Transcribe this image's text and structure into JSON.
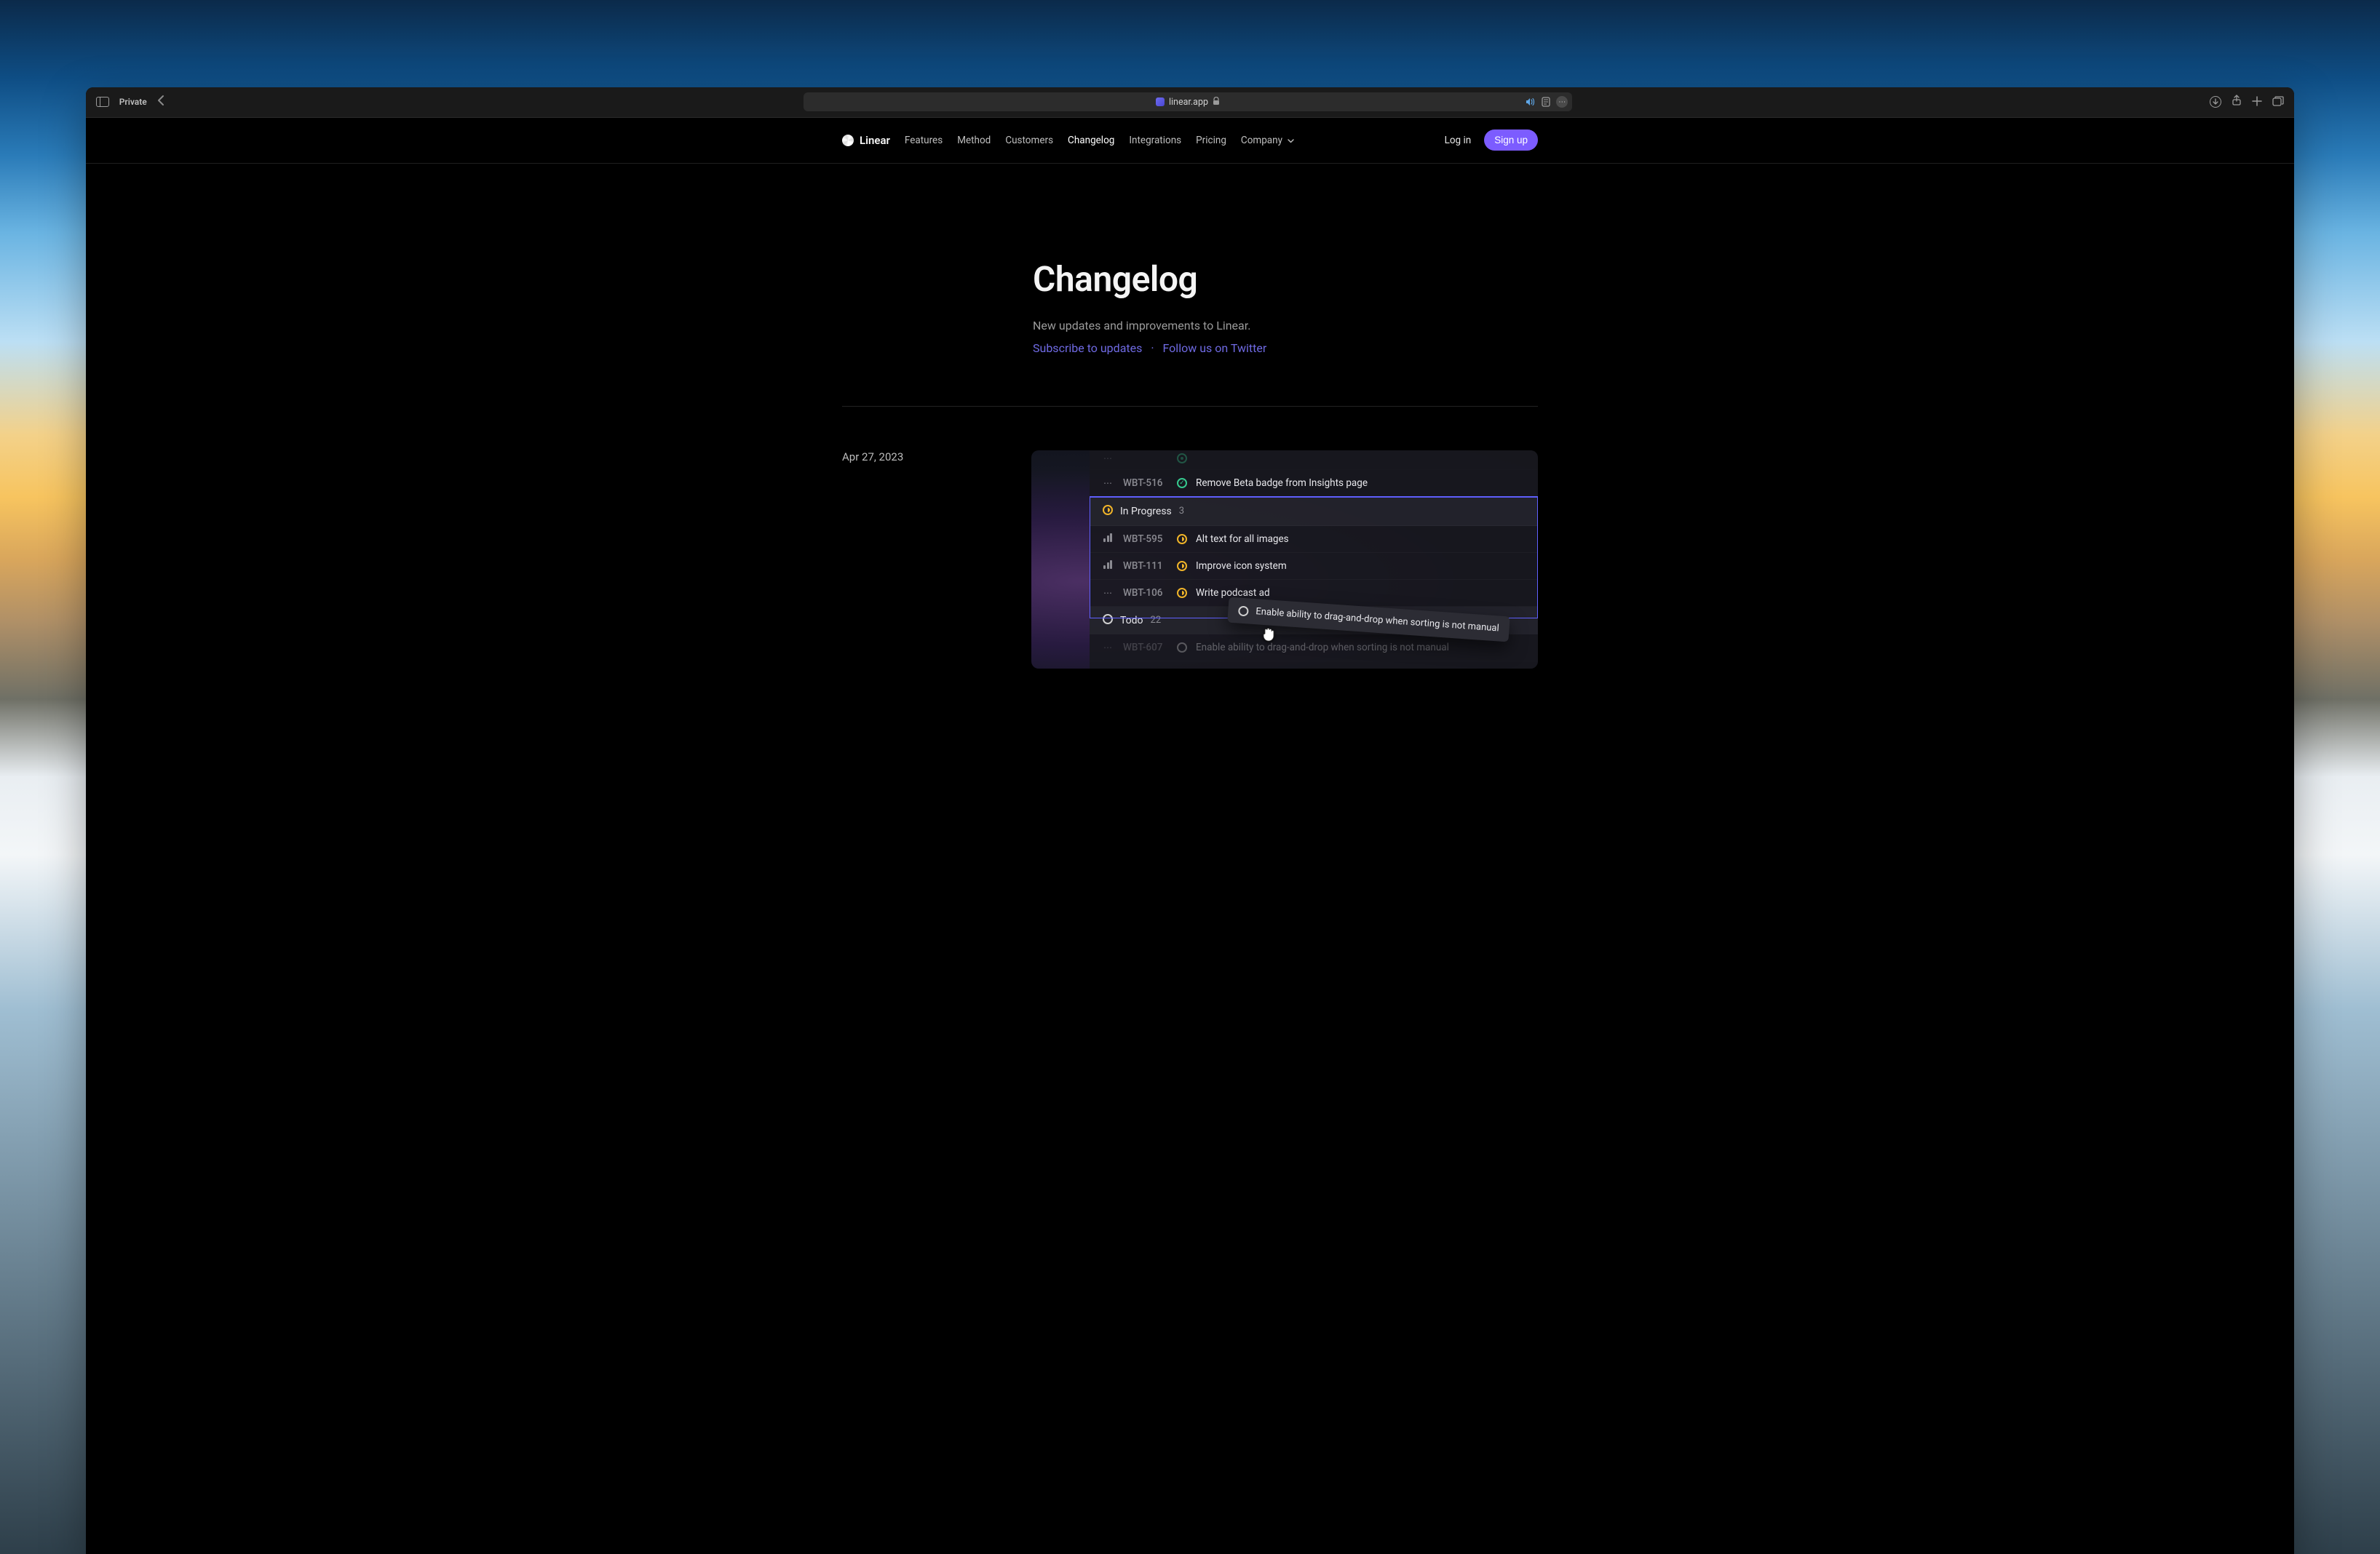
{
  "browser": {
    "private_label": "Private",
    "url": "linear.app"
  },
  "site": {
    "brand": "Linear",
    "nav": {
      "features": "Features",
      "method": "Method",
      "customers": "Customers",
      "changelog": "Changelog",
      "integrations": "Integrations",
      "pricing": "Pricing",
      "company": "Company"
    },
    "login": "Log in",
    "signup": "Sign up"
  },
  "hero": {
    "title": "Changelog",
    "subtitle": "New updates and improvements to Linear.",
    "subscribe": "Subscribe to updates",
    "twitter": "Follow us on Twitter"
  },
  "entry": {
    "date": "Apr 27, 2023"
  },
  "kanban": {
    "groups": {
      "in_progress": {
        "label": "In Progress",
        "count": "3"
      },
      "todo": {
        "label": "Todo",
        "count": "22"
      }
    },
    "rows": {
      "r0": {
        "id": "",
        "title": ""
      },
      "r1": {
        "id": "WBT-516",
        "title": "Remove Beta badge from Insights page"
      },
      "r2": {
        "id": "WBT-595",
        "title": "Alt text for all images"
      },
      "r3": {
        "id": "WBT-111",
        "title": "Improve icon system"
      },
      "r4": {
        "id": "WBT-106",
        "title": "Write podcast ad"
      },
      "r5": {
        "id": "WBT-607",
        "title": "Enable ability to drag-and-drop when sorting is not manual"
      }
    },
    "drag_label": "Enable ability to drag-and-drop when sorting is not manual"
  }
}
